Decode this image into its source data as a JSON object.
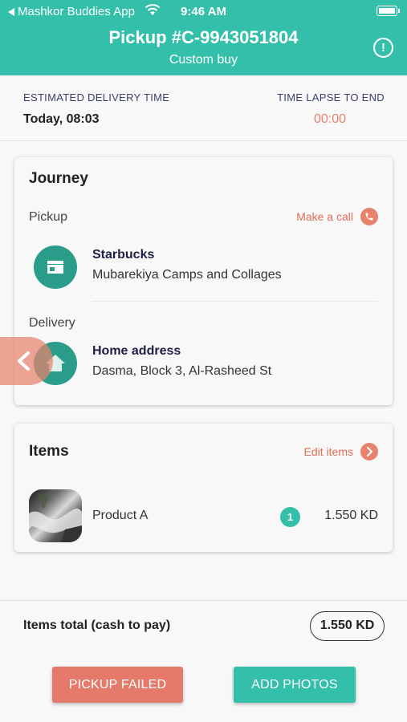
{
  "status_bar": {
    "back_app": "Mashkor Buddies App",
    "time": "9:46 AM"
  },
  "header": {
    "title": "Pickup #C-9943051804",
    "subtitle": "Custom buy",
    "info_glyph": "!"
  },
  "eta": {
    "left_label": "ESTIMATED DELIVERY TIME",
    "left_value": "Today, 08:03",
    "right_label": "TIME LAPSE TO END",
    "right_value": "00:00"
  },
  "journey": {
    "title": "Journey",
    "pickup_label": "Pickup",
    "call_label": "Make a call",
    "pickup_name": "Starbucks",
    "pickup_address": "Mubarekiya Camps and Collages",
    "delivery_label": "Delivery",
    "delivery_name": "Home address",
    "delivery_address": "Dasma, Block 3, Al-Rasheed St"
  },
  "items": {
    "title": "Items",
    "edit_label": "Edit items",
    "list": [
      {
        "name": "Product A",
        "quantity": "1",
        "price": "1.550 KD"
      }
    ]
  },
  "footer": {
    "total_label": "Items total (cash to pay)",
    "total_value": "1.550 KD",
    "failed_button": "PICKUP FAILED",
    "photos_button": "ADD PHOTOS"
  },
  "colors": {
    "brand": "#34bfab",
    "accent": "#e8826d",
    "icon_bg": "#2a9d8a"
  },
  "icons": [
    "back-arrow-icon",
    "wifi-icon",
    "battery-icon",
    "info-icon",
    "phone-icon",
    "store-icon",
    "home-icon",
    "chevron-left-icon",
    "chevron-right-icon"
  ]
}
